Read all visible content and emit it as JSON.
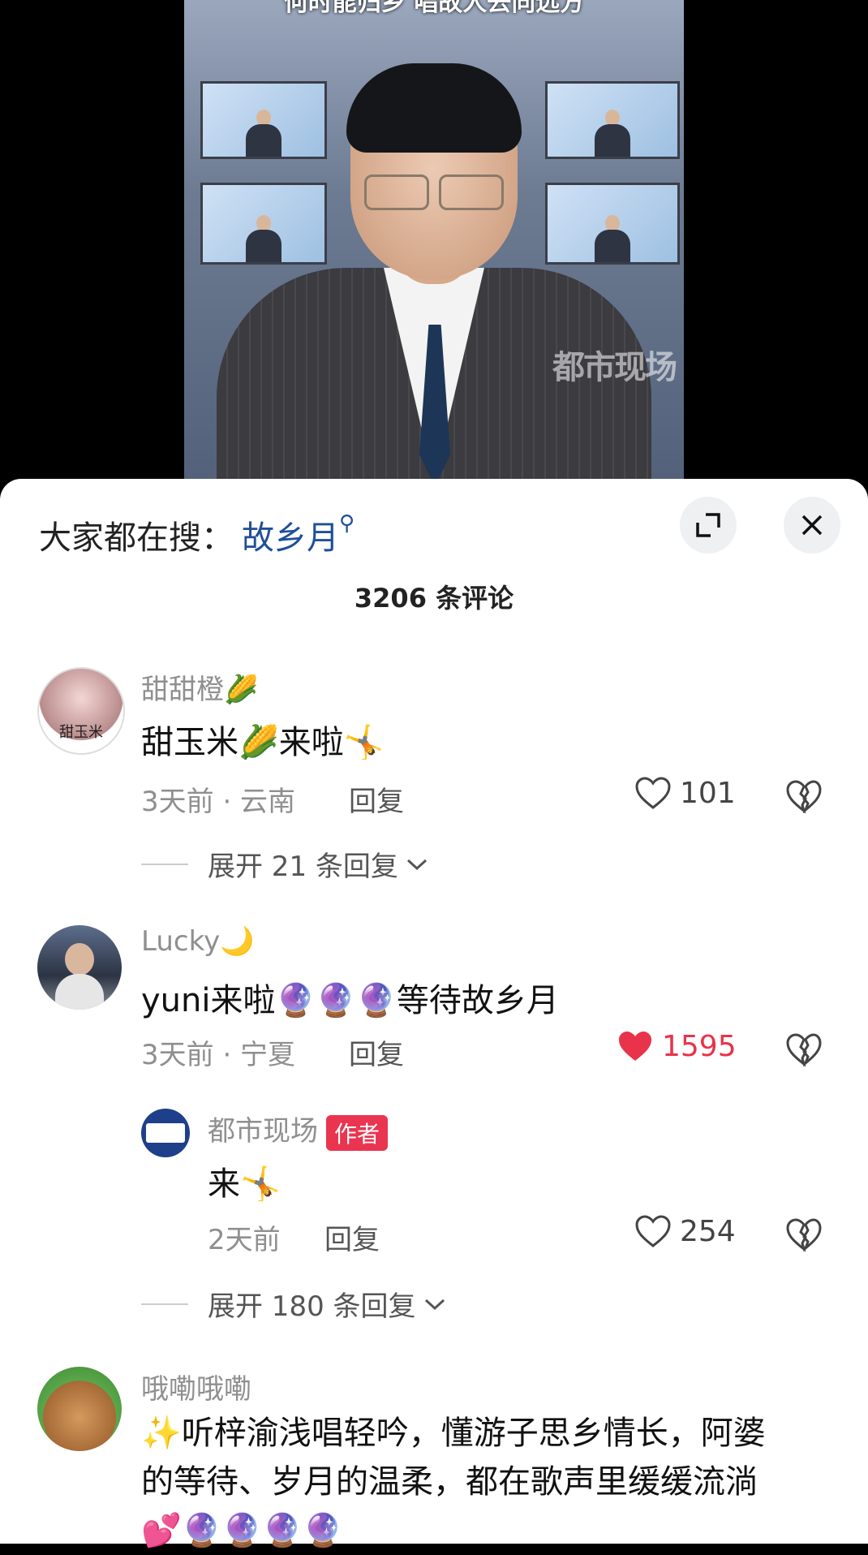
{
  "video": {
    "caption": "何时能归乡 唱故人去向远方",
    "watermark": "都市现场"
  },
  "header": {
    "search_prefix": "大家都在搜：",
    "search_keyword": "故乡月",
    "comment_count": "3206 条评论"
  },
  "comments": [
    {
      "user": "甜甜橙🌽",
      "text": "甜玉米🌽来啦🤸",
      "time_location": "3天前 · 云南",
      "reply_label": "回复",
      "likes": "101",
      "liked": false,
      "expand": "展开 21 条回复",
      "avatar_text": "甜玉米"
    },
    {
      "user": "Lucky🌙",
      "text": "yuni来啦🔮🔮🔮等待故乡月",
      "time_location": "3天前 · 宁夏",
      "reply_label": "回复",
      "likes": "1595",
      "liked": true,
      "reply": {
        "user": "都市现场",
        "badge": "作者",
        "text": "来🤸",
        "time": "2天前",
        "reply_label": "回复",
        "likes": "254"
      },
      "expand": "展开 180 条回复"
    },
    {
      "user": "哦嘞哦嘞",
      "text_line1": "✨听梓渝浅唱轻吟，懂游子思乡情长，阿婆",
      "text_line2": "的等待、岁月的温柔，都在歌声里缓缓流淌",
      "text_line3": "💕🔮🔮🔮🔮"
    }
  ],
  "colors": {
    "liked": "#e8334a",
    "keyword": "#1f4f9a",
    "badge": "#ea3550"
  }
}
